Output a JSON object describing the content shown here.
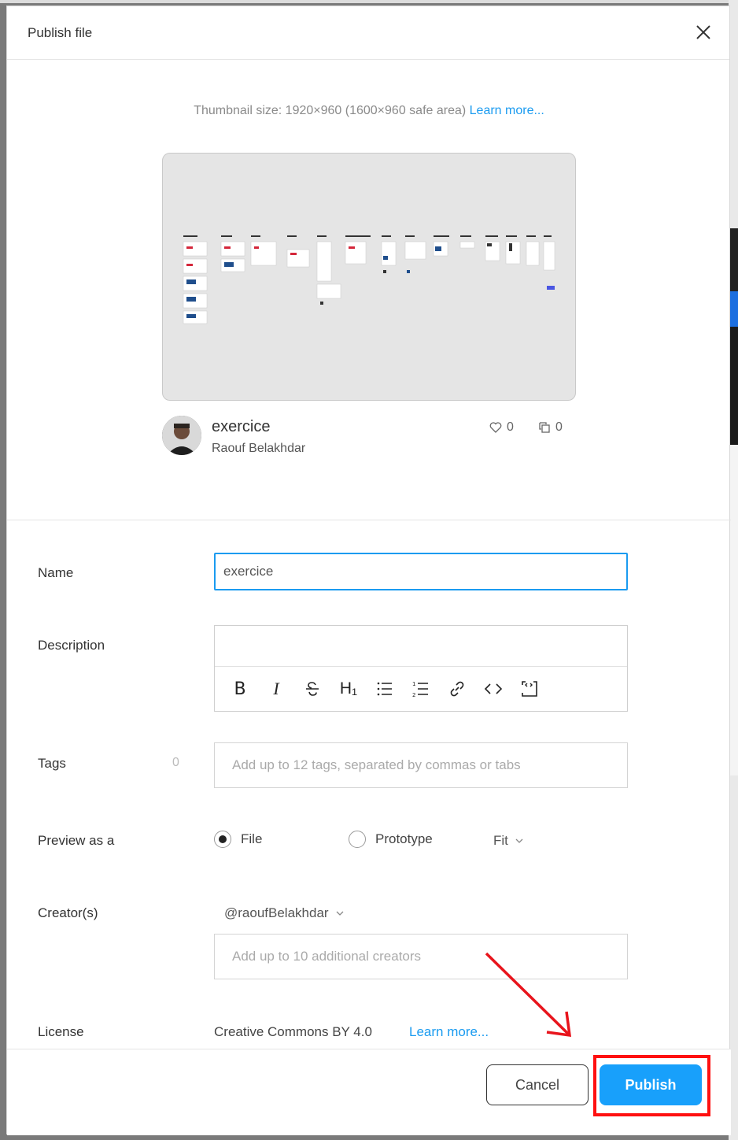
{
  "dialog": {
    "title": "Publish file"
  },
  "thumbnail": {
    "note": "Thumbnail size: 1920×960 (1600×960 safe area)",
    "learn_more": "Learn more..."
  },
  "file": {
    "name": "exercice",
    "author": "Raouf Belakhdar",
    "likes": "0",
    "duplicates": "0"
  },
  "form": {
    "name_label": "Name",
    "name_value": "exercice",
    "description_label": "Description",
    "tags_label": "Tags",
    "tags_count": "0",
    "tags_placeholder": "Add up to 12 tags, separated by commas or tabs",
    "preview_label": "Preview as a",
    "preview_options": [
      "File",
      "Prototype"
    ],
    "preview_selected": "File",
    "fit_label": "Fit",
    "creators_label": "Creator(s)",
    "creator_handle": "@raoufBelakhdar",
    "creators_placeholder": "Add up to 10 additional creators",
    "license_label": "License",
    "license_value": "Creative Commons BY 4.0",
    "license_link": "Learn more..."
  },
  "toolbar": {
    "bold": "B",
    "italic": "I",
    "heading": "H₁"
  },
  "footer": {
    "cancel_label": "Cancel",
    "publish_label": "Publish"
  },
  "colors": {
    "accent": "#18a0fb",
    "highlight": "#ff1010"
  }
}
